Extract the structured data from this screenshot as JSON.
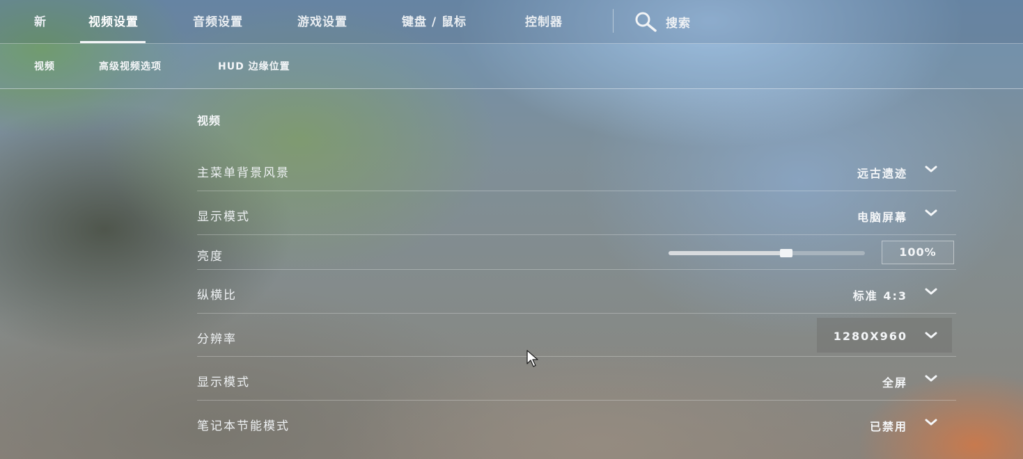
{
  "top_nav": {
    "tabs": [
      {
        "label": "新",
        "active": false
      },
      {
        "label": "视频设置",
        "active": true
      },
      {
        "label": "音频设置",
        "active": false
      },
      {
        "label": "游戏设置",
        "active": false
      },
      {
        "label": "键盘 / 鼠标",
        "active": false
      },
      {
        "label": "控制器",
        "active": false
      }
    ],
    "search": {
      "label": "搜索",
      "icon": "search-icon"
    }
  },
  "sub_nav": {
    "tabs": [
      {
        "label": "视频"
      },
      {
        "label": "高级视频选项"
      },
      {
        "label": "HUD 边缘位置"
      }
    ]
  },
  "section": {
    "title": "视频"
  },
  "settings": [
    {
      "label": "主菜单背景风景",
      "value": "远古遗迹",
      "control": "dropdown"
    },
    {
      "label": "显示模式",
      "value": "电脑屏幕",
      "control": "dropdown"
    },
    {
      "label": "亮度",
      "value": "100%",
      "control": "slider",
      "slider_fraction": 0.6
    },
    {
      "label": "纵横比",
      "value": "标准 4:3",
      "control": "dropdown"
    },
    {
      "label": "分辨率",
      "value": "1280X960",
      "control": "dropdown",
      "highlighted": true
    },
    {
      "label": "显示模式",
      "value": "全屏",
      "control": "dropdown"
    },
    {
      "label": "笔记本节能模式",
      "value": "已禁用",
      "control": "dropdown"
    }
  ]
}
